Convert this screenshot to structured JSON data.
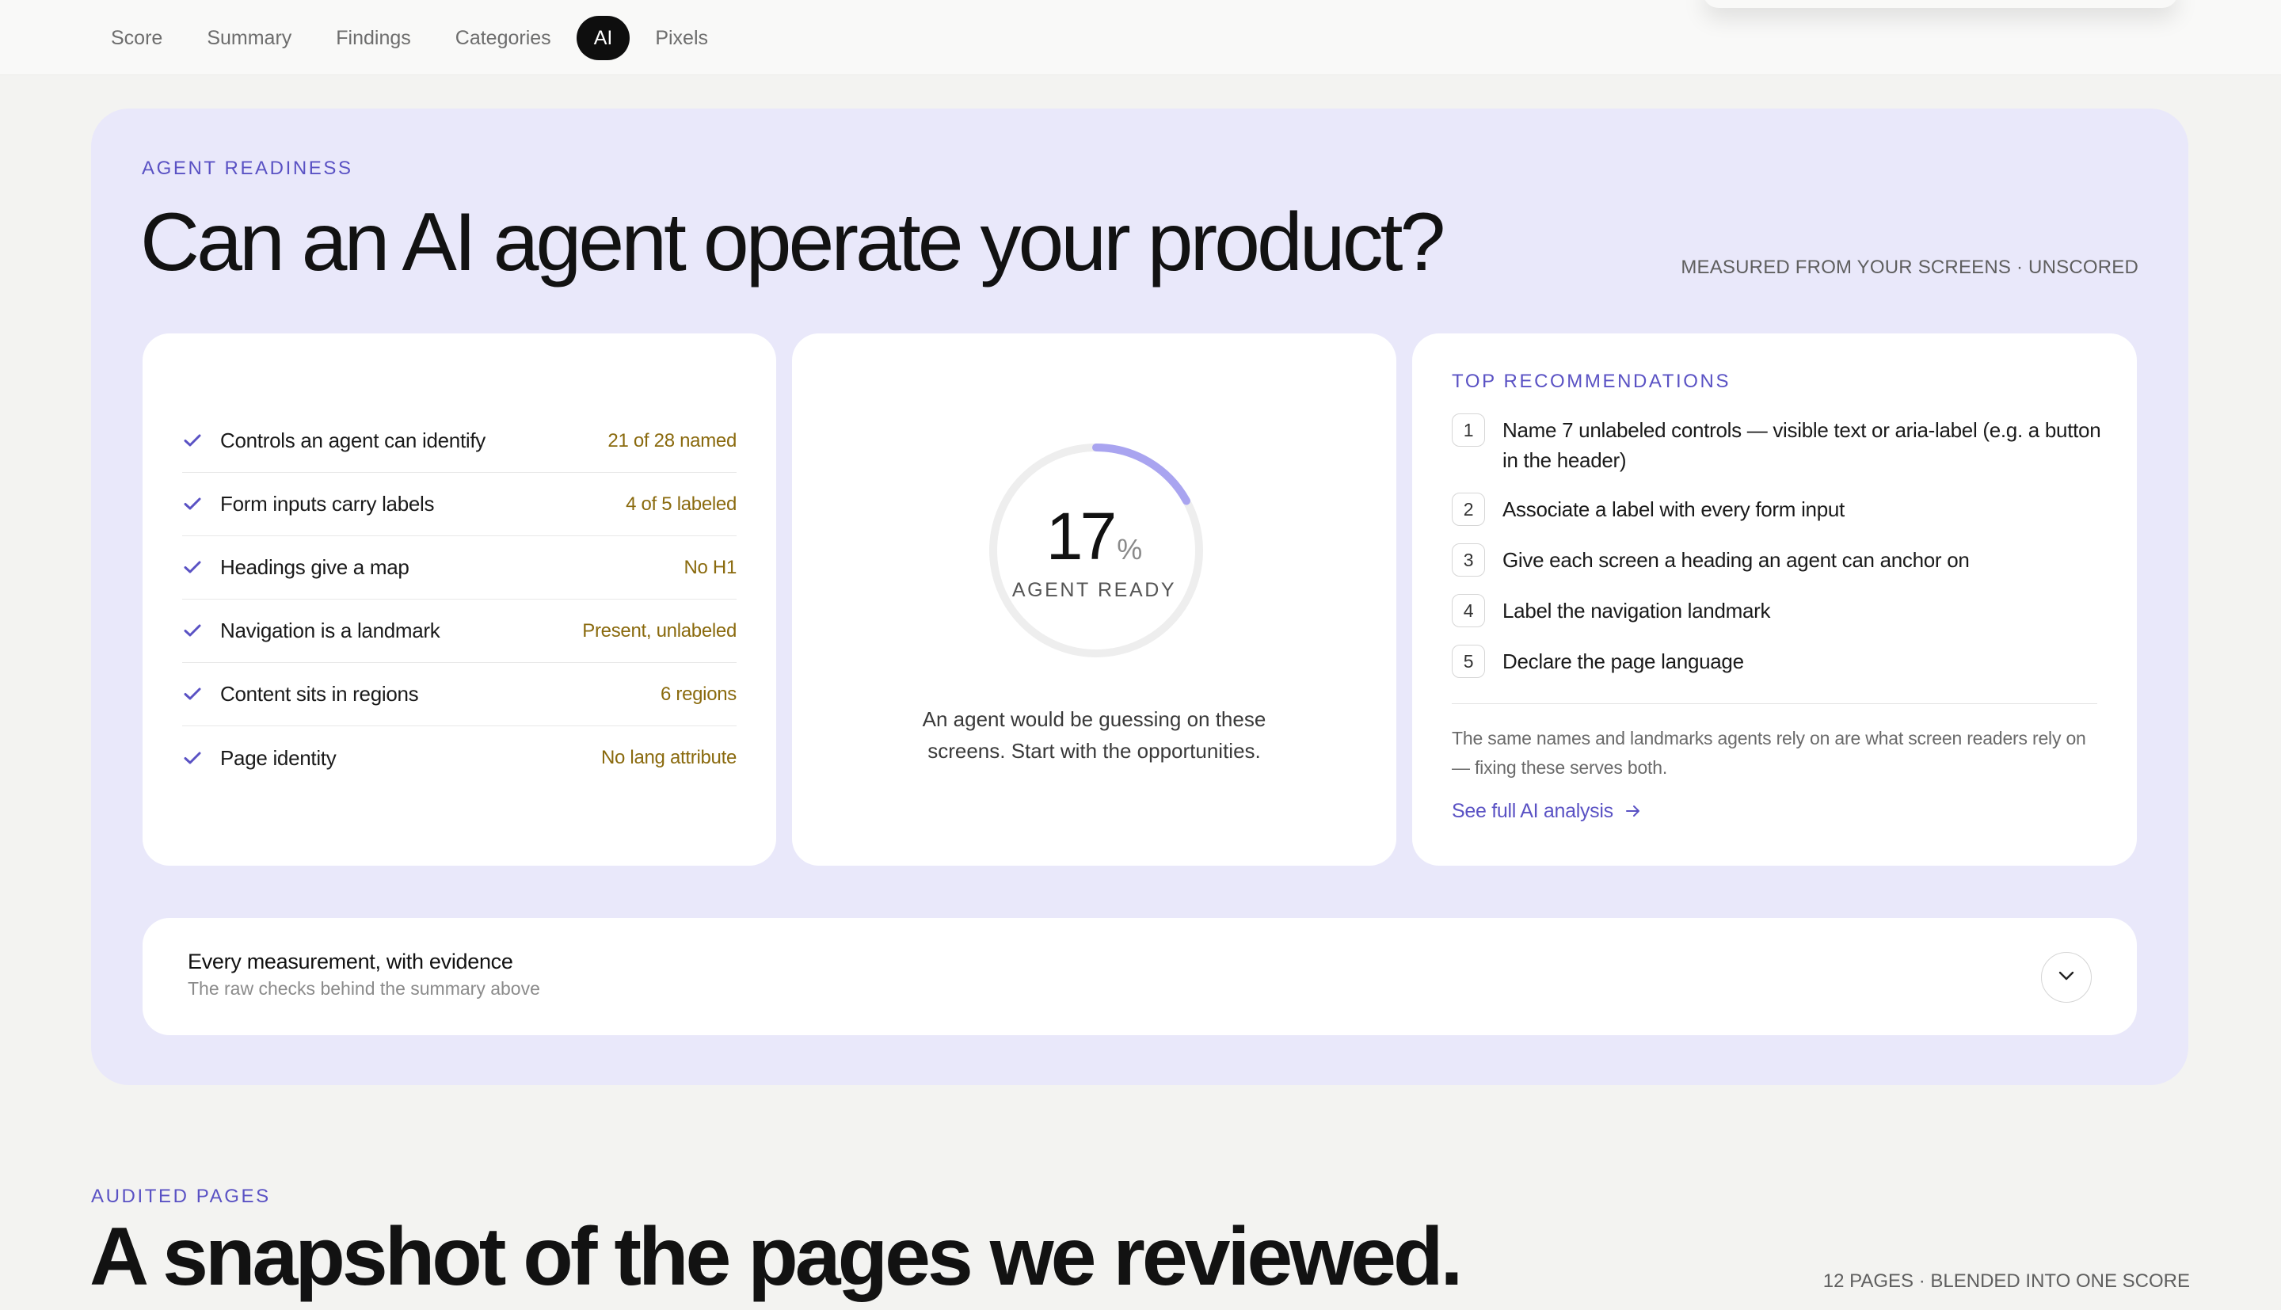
{
  "nav": {
    "tabs": [
      {
        "label": "Score",
        "active": false
      },
      {
        "label": "Summary",
        "active": false
      },
      {
        "label": "Findings",
        "active": false
      },
      {
        "label": "Categories",
        "active": false
      },
      {
        "label": "AI",
        "active": true
      },
      {
        "label": "Pixels",
        "active": false
      }
    ]
  },
  "panel": {
    "eyebrow": "AGENT READINESS",
    "title": "Can an AI agent operate your product?",
    "meta": "MEASURED FROM YOUR SCREENS · UNSCORED",
    "accent_color": "#5a52c4",
    "background_color": "#e9e8fa"
  },
  "checks": [
    {
      "label": "Controls an agent can identify",
      "value": "21 of 28 named",
      "icon": "check-icon"
    },
    {
      "label": "Form inputs carry labels",
      "value": "4 of 5 labeled",
      "icon": "check-icon"
    },
    {
      "label": "Headings give a map",
      "value": "No H1",
      "icon": "check-icon"
    },
    {
      "label": "Navigation is a landmark",
      "value": "Present, unlabeled",
      "icon": "check-icon"
    },
    {
      "label": "Content sits in regions",
      "value": "6 regions",
      "icon": "check-icon"
    },
    {
      "label": "Page identity",
      "value": "No lang attribute",
      "icon": "check-icon"
    }
  ],
  "score": {
    "value": "17",
    "percent": 17,
    "unit": "%",
    "label": "AGENT READY",
    "description": "An agent would be guessing on these screens. Start with the opportunities.",
    "ring_color": "#a9a4f0",
    "track_color": "#eeeeee"
  },
  "recommendations": {
    "eyebrow": "TOP RECOMMENDATIONS",
    "items": [
      {
        "num": "1",
        "text": "Name 7 unlabeled controls — visible text or aria-label (e.g. a button in the header)"
      },
      {
        "num": "2",
        "text": "Associate a label with every form input"
      },
      {
        "num": "3",
        "text": "Give each screen a heading an agent can anchor on"
      },
      {
        "num": "4",
        "text": "Label the navigation landmark"
      },
      {
        "num": "5",
        "text": "Declare the page language"
      }
    ],
    "note": "The same names and landmarks agents rely on are what screen readers rely on — fixing these serves both.",
    "link": "See full AI analysis",
    "link_icon": "arrow-right-icon"
  },
  "accordion": {
    "title": "Every measurement, with evidence",
    "subtitle": "The raw checks behind the summary above",
    "icon": "chevron-down-icon"
  },
  "audited": {
    "eyebrow": "AUDITED PAGES",
    "title": "A snapshot of the pages we reviewed.",
    "meta": "12 PAGES · BLENDED INTO ONE SCORE"
  }
}
